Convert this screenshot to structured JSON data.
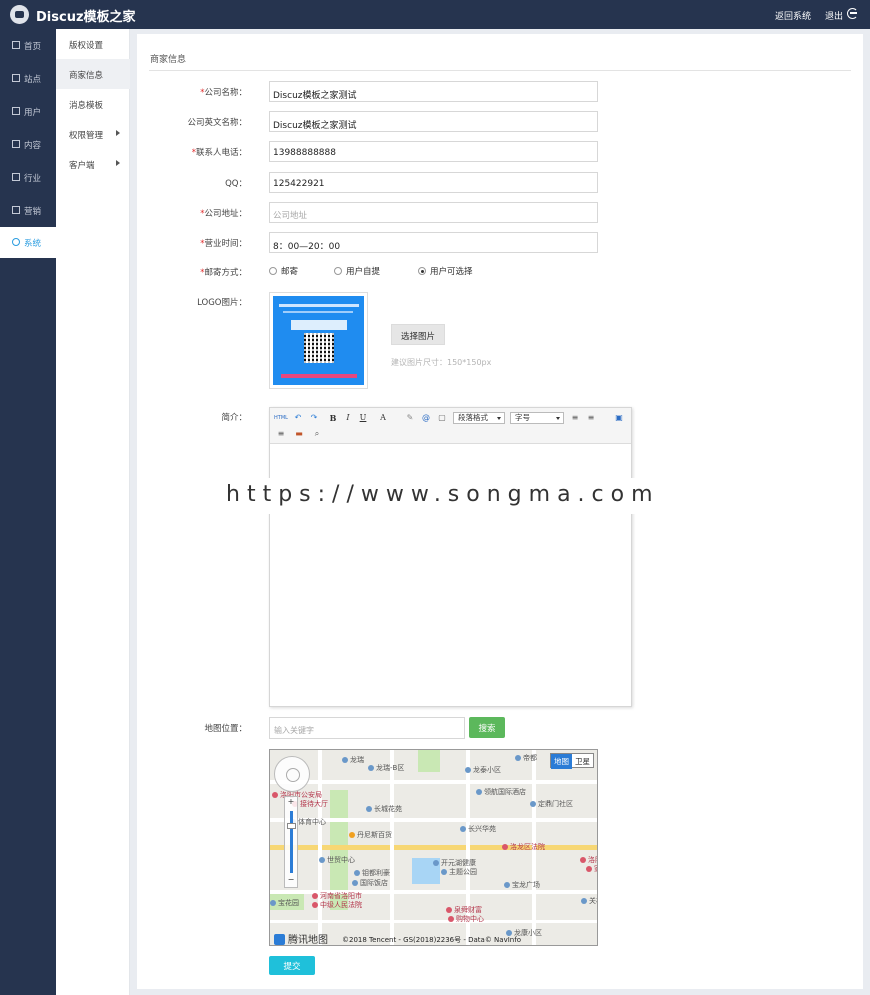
{
  "app": {
    "title": "Discuz模板之家",
    "back_label": "返回系统",
    "logout_label": "退出"
  },
  "sidebar": {
    "items": [
      {
        "label": "首页",
        "icon": "home-icon"
      },
      {
        "label": "站点",
        "icon": "monitor-icon"
      },
      {
        "label": "用户",
        "icon": "user-icon"
      },
      {
        "label": "内容",
        "icon": "content-icon"
      },
      {
        "label": "行业",
        "icon": "star-icon"
      },
      {
        "label": "营销",
        "icon": "marketing-icon"
      },
      {
        "label": "系统",
        "icon": "settings-icon"
      }
    ],
    "active": "系统"
  },
  "subnav": {
    "items": [
      {
        "label": "版权设置"
      },
      {
        "label": "商家信息"
      },
      {
        "label": "消息模板"
      },
      {
        "label": "权限管理"
      },
      {
        "label": "客户端"
      }
    ],
    "active": "商家信息"
  },
  "form": {
    "section_title": "商家信息",
    "company_name": {
      "label": "公司名称：",
      "value": "Discuz模板之家测试"
    },
    "company_en_name": {
      "label": "公司英文名称：",
      "value": "Discuz模板之家测试"
    },
    "phone": {
      "label": "联系人电话：",
      "value": "13988888888"
    },
    "qq": {
      "label": "QQ：",
      "value": "125422921"
    },
    "address": {
      "label": "公司地址：",
      "placeholder": "公司地址"
    },
    "hours": {
      "label": "营业时间：",
      "value": "8：00—20：00"
    },
    "shipping": {
      "label": "邮寄方式：",
      "options": [
        "邮寄",
        "用户自提",
        "用户可选择"
      ],
      "selected": "用户可选择"
    },
    "logo": {
      "label": "LOGO图片：",
      "choose_label": "选择图片",
      "hint": "建议图片尺寸：150*150px"
    },
    "intro": {
      "label": "简介：",
      "toolbar": {
        "html": "HTML",
        "bold": "B",
        "italic": "I",
        "underline": "U",
        "font_color": "A",
        "paragraph_select": "段落格式",
        "font_size_select": "字号"
      }
    },
    "map_location": {
      "label": "地图位置：",
      "search_placeholder": "输入关键字",
      "search_label": "搜索"
    },
    "submit_label": "提交"
  },
  "map": {
    "toggle": [
      "地图",
      "卫星"
    ],
    "brand": "腾讯地图",
    "copyright": "©2018 Tencent - GS(2018)2236号 - Data© NavInfo",
    "pois": {
      "p1": "龙瑞",
      "p2": "龙瑞-B区",
      "p3": "龙泰小区",
      "p4": "帝都",
      "p5": "洛阳市公安局",
      "p6": "接待大厅",
      "p7": "领航国际酒店",
      "p8": "定鼎门社区",
      "p9": "长城花苑",
      "p10": "体育中心",
      "p11": "丹尼斯百货",
      "p12": "长兴华苑",
      "p13": "洛龙区法院",
      "p14": "世贸中心",
      "p15": "开元湖健康",
      "p16": "主题公园",
      "p17": "钼都利豪",
      "p18": "国际饭店",
      "p19": "宝龙广场",
      "p20": "洛阳",
      "p21": "家园",
      "p22": "河南省洛阳市",
      "p23": "中级人民法院",
      "p24": "泉舜财富",
      "p25": "购物中心",
      "p26": "宝花园",
      "p27": "关林",
      "p28": "龙康小区"
    }
  },
  "watermark": "https://www.songma.com",
  "colors": {
    "nav_bg": "#26344f",
    "accent": "#2a9ce0",
    "search": "#5cb85c",
    "submit": "#1fc0da"
  }
}
